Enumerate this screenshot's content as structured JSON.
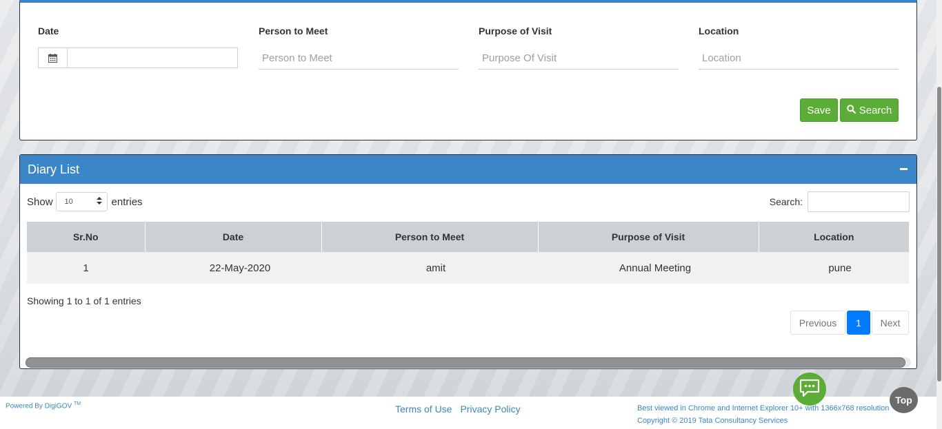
{
  "form": {
    "date_label": "Date",
    "date_value": "",
    "person_label": "Person to Meet",
    "person_placeholder": "Person to Meet",
    "purpose_label": "Purpose of Visit",
    "purpose_placeholder": "Purpose Of Visit",
    "location_label": "Location",
    "location_placeholder": "Location",
    "save_label": "Save",
    "search_label": "Search"
  },
  "diary": {
    "title": "Diary List",
    "show_label": "Show",
    "page_length": "10",
    "entries_label": "entries",
    "search_label": "Search:",
    "columns": [
      "Sr.No",
      "Date",
      "Person to Meet",
      "Purpose of Visit",
      "Location"
    ],
    "rows": [
      [
        "1",
        "22-May-2020",
        "amit",
        "Annual Meeting",
        "pune"
      ]
    ],
    "info": "Showing 1 to 1 of 1 entries",
    "pagination": {
      "previous": "Previous",
      "current": "1",
      "next": "Next"
    }
  },
  "footer": {
    "powered_by": "Powered By DigiGOV",
    "tm": "TM",
    "terms": "Terms of Use",
    "privacy": "Privacy Policy",
    "best_viewed": "Best viewed in Chrome and Internet Explorer 10+ with 1366x768 resolution",
    "copyright": "Copyright © 2019 Tata Consultancy Services"
  },
  "top_button": "Top",
  "colors": {
    "primary": "#3a86c8",
    "success": "#5aad35",
    "pager_active": "#007bff"
  }
}
